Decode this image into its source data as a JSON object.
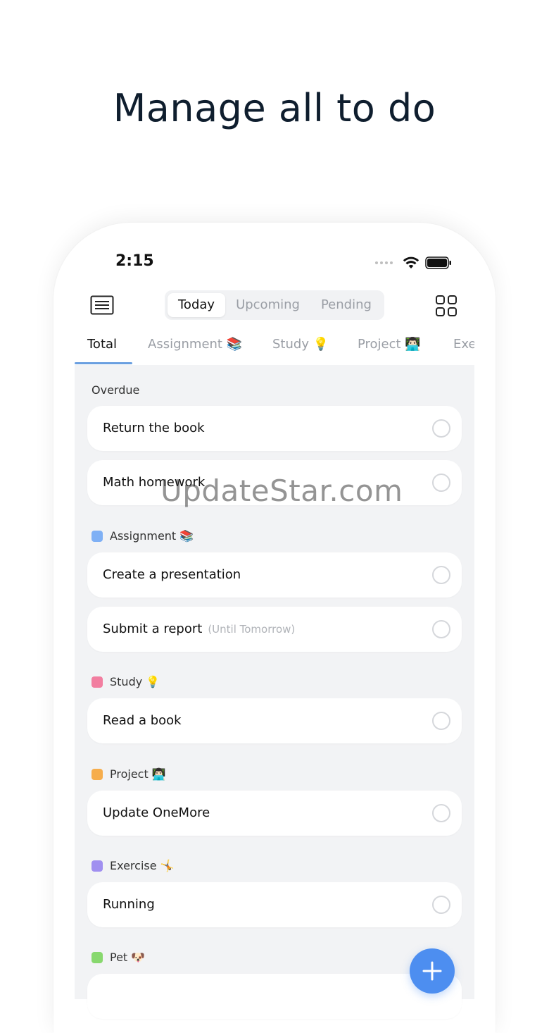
{
  "headline": "Manage all to do",
  "status": {
    "time": "2:15"
  },
  "segments": {
    "today": "Today",
    "upcoming": "Upcoming",
    "pending": "Pending"
  },
  "categories": {
    "total": "Total",
    "assignment": "Assignment 📚",
    "study": "Study 💡",
    "project": "Project 👨🏻‍💻",
    "exercise_partial": "Exe"
  },
  "sections": {
    "overdue": {
      "label": "Overdue"
    },
    "assignment": {
      "label": "Assignment 📚",
      "color": "#7fb0f5"
    },
    "study": {
      "label": "Study 💡",
      "color": "#f27ea0"
    },
    "project": {
      "label": "Project 👨🏻‍💻",
      "color": "#f6ad4c"
    },
    "exercise": {
      "label": "Exercise 🤸",
      "color": "#a08ff0"
    },
    "pet": {
      "label": "Pet 🐶",
      "color": "#88d86e"
    }
  },
  "tasks": {
    "return_book": "Return the book",
    "math_homework": "Math homework",
    "create_presentation": "Create a presentation",
    "submit_report": "Submit a report",
    "submit_report_note": "(Until Tomorrow)",
    "read_book": "Read a book",
    "update_onemore": "Update OneMore",
    "running": "Running"
  },
  "watermark": "UpdateStar.com",
  "colors": {
    "accent": "#4d8ef0",
    "tab_underline": "#6a9fe0"
  }
}
